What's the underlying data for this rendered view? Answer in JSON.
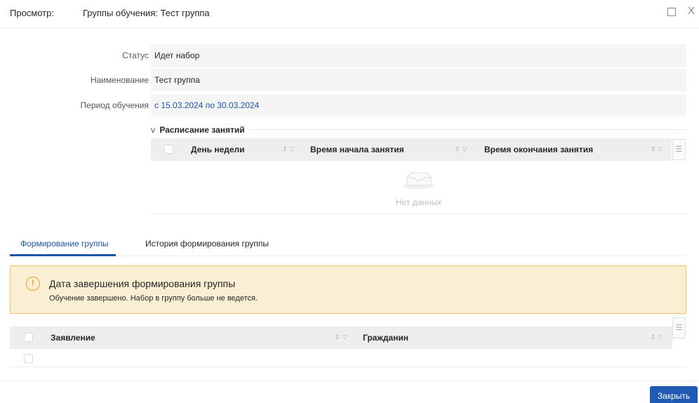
{
  "header": {
    "prefix": "Просмотр:",
    "title": "Группы обучения: Тест группа",
    "maximize_icon": "maximize-icon",
    "close_icon": "close-icon",
    "close_glyph": "X"
  },
  "fields": [
    {
      "label": "Статус",
      "value": "Идет набор"
    },
    {
      "label": "Наименование",
      "value": "Тест группа"
    },
    {
      "label": "Период обучения",
      "value": "с 15.03.2024 по 30.03.2024"
    }
  ],
  "schedule": {
    "toggle_glyph": "v",
    "title": "Расписание занятий",
    "columns": [
      "День недели",
      "Время начала занятия",
      "Время окончания занятия"
    ],
    "sort_filter_glyph": "⇕▽",
    "column_settings_glyph": "☰",
    "empty_text": "Нет данных"
  },
  "tabs": [
    {
      "label": "Формирование группы",
      "active": true
    },
    {
      "label": "История формирования группы",
      "active": false
    }
  ],
  "alert": {
    "icon_glyph": "!",
    "title": "Дата завершения формирования группы",
    "text": "Обучение завершено. Набор в группу больше не ведется."
  },
  "applications_table": {
    "columns": [
      "Заявление",
      "Гражданин"
    ],
    "rows_shown": 1
  },
  "footer": {
    "close_label": "Закрыть"
  },
  "colors": {
    "accent": "#1f5bb5",
    "link": "#1a56a8",
    "warning_bg": "#fbefd3",
    "warning_border": "#f0c36a",
    "warning_icon": "#eca02a"
  }
}
